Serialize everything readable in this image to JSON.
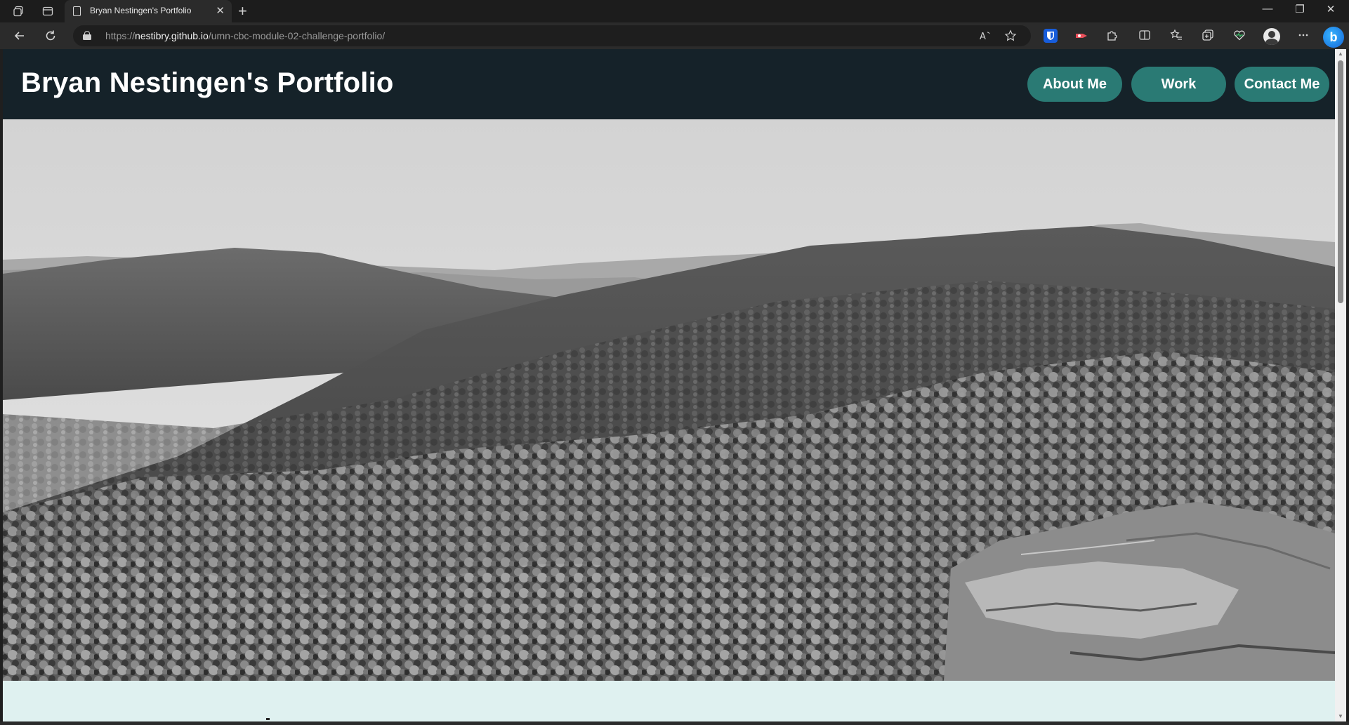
{
  "browser": {
    "tab_title": "Bryan Nestingen's Portfolio",
    "tab_close": "✕",
    "new_tab": "+",
    "url_scheme": "https://",
    "url_host": "nestibry.github.io",
    "url_path": "/umn-cbc-module-02-challenge-portfolio/",
    "window_controls": {
      "minimize": "—",
      "restore": "❐",
      "close": "✕"
    },
    "icons": [
      "workspaces-icon",
      "tab-actions-icon",
      "back-icon",
      "refresh-icon",
      "lock-icon",
      "read-aloud-icon",
      "favorite-star-icon",
      "extension-bitwarden-icon",
      "extension-red-icon",
      "extensions-puzzle-icon",
      "split-screen-icon",
      "favorites-icon",
      "collections-icon",
      "browser-essentials-icon",
      "profile-icon",
      "more-icon",
      "bing-copilot-icon"
    ]
  },
  "site": {
    "title": "Bryan Nestingen's Portfolio",
    "nav": [
      {
        "label": "About Me"
      },
      {
        "label": "Work"
      },
      {
        "label": "Contact Me"
      }
    ],
    "hero_image_alt_semantic": "mountain-landscape-image",
    "colors": {
      "header_bg": "#152229",
      "nav_pill_bg": "#2a7a74",
      "page_bg": "#dff1f0"
    }
  }
}
